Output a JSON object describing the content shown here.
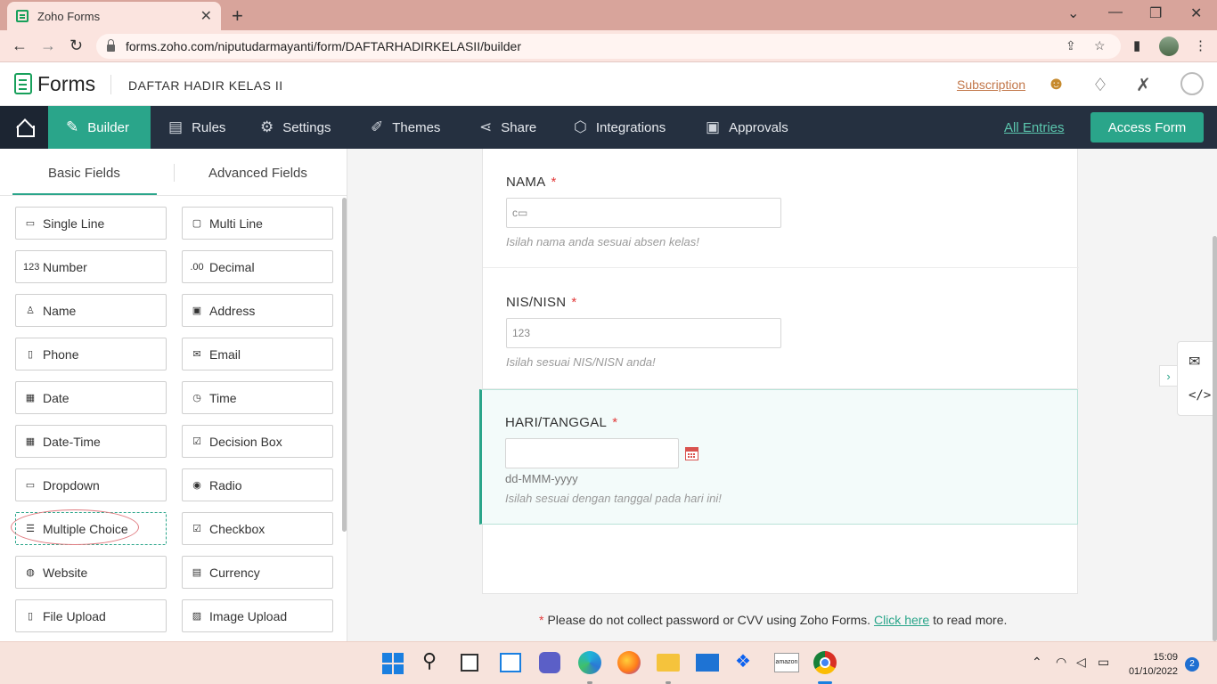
{
  "browser": {
    "tab_title": "Zoho Forms",
    "url": "forms.zoho.com/niputudarmayanti/form/DAFTARHADIRKELASII/builder"
  },
  "header": {
    "brand": "Forms",
    "form_name": "DAFTAR HADIR KELAS II",
    "subscription": "Subscription"
  },
  "navbar": {
    "tabs": [
      {
        "label": "Builder",
        "icon": "builder-icon"
      },
      {
        "label": "Rules",
        "icon": "rules-icon"
      },
      {
        "label": "Settings",
        "icon": "gear-icon"
      },
      {
        "label": "Themes",
        "icon": "brush-icon"
      },
      {
        "label": "Share",
        "icon": "share-icon"
      },
      {
        "label": "Integrations",
        "icon": "puzzle-icon"
      },
      {
        "label": "Approvals",
        "icon": "approvals-icon"
      }
    ],
    "all_entries": "All Entries",
    "access_form": "Access Form"
  },
  "left_panel": {
    "tabs": {
      "basic": "Basic Fields",
      "advanced": "Advanced Fields"
    },
    "fields": [
      {
        "label": "Single Line",
        "icon": "single-line-icon",
        "glyph": "▭"
      },
      {
        "label": "Multi Line",
        "icon": "multi-line-icon",
        "glyph": "▢"
      },
      {
        "label": "Number",
        "icon": "number-icon",
        "glyph": "123"
      },
      {
        "label": "Decimal",
        "icon": "decimal-icon",
        "glyph": ".00"
      },
      {
        "label": "Name",
        "icon": "person-icon",
        "glyph": "♙"
      },
      {
        "label": "Address",
        "icon": "address-icon",
        "glyph": "▣"
      },
      {
        "label": "Phone",
        "icon": "phone-icon",
        "glyph": "▯"
      },
      {
        "label": "Email",
        "icon": "envelope-icon",
        "glyph": "✉"
      },
      {
        "label": "Date",
        "icon": "calendar-icon",
        "glyph": "▦"
      },
      {
        "label": "Time",
        "icon": "clock-icon",
        "glyph": "◷"
      },
      {
        "label": "Date-Time",
        "icon": "date-time-icon",
        "glyph": "▦"
      },
      {
        "label": "Decision Box",
        "icon": "checkbox-icon",
        "glyph": "☑"
      },
      {
        "label": "Dropdown",
        "icon": "dropdown-icon",
        "glyph": "▭"
      },
      {
        "label": "Radio",
        "icon": "radio-icon",
        "glyph": "◉"
      },
      {
        "label": "Multiple Choice",
        "icon": "multiple-choice-icon",
        "glyph": "☰"
      },
      {
        "label": "Checkbox",
        "icon": "checklist-icon",
        "glyph": "☑"
      },
      {
        "label": "Website",
        "icon": "globe-icon",
        "glyph": "◍"
      },
      {
        "label": "Currency",
        "icon": "currency-icon",
        "glyph": "▤"
      },
      {
        "label": "File Upload",
        "icon": "file-icon",
        "glyph": "▯"
      },
      {
        "label": "Image Upload",
        "icon": "image-icon",
        "glyph": "▨"
      }
    ]
  },
  "form": {
    "fields": [
      {
        "label": "NAMA",
        "required": "*",
        "input_placeholder": "",
        "hint": "Isilah nama anda sesuai absen kelas!"
      },
      {
        "label": "NIS/NISN",
        "required": "*",
        "input_placeholder": "123",
        "hint": "Isilah sesuai NIS/NISN anda!"
      },
      {
        "label": "HARI/TANGGAL",
        "required": "*",
        "format": "dd-MMM-yyyy",
        "hint": "Isilah sesuai dengan tanggal pada hari ini!"
      }
    ],
    "notice": {
      "asterisk": "*",
      "text": "Please do not collect password or CVV using Zoho Forms.",
      "link": "Click here",
      "suffix": "to read more."
    }
  },
  "taskbar": {
    "time": "15:09",
    "date": "01/10/2022",
    "notifications": "2",
    "amazon_label": "amazon"
  },
  "colors": {
    "accent": "#2aa58a",
    "navbar": "#253040",
    "required": "#e23b3b",
    "tabbar": "#d8a49b"
  }
}
